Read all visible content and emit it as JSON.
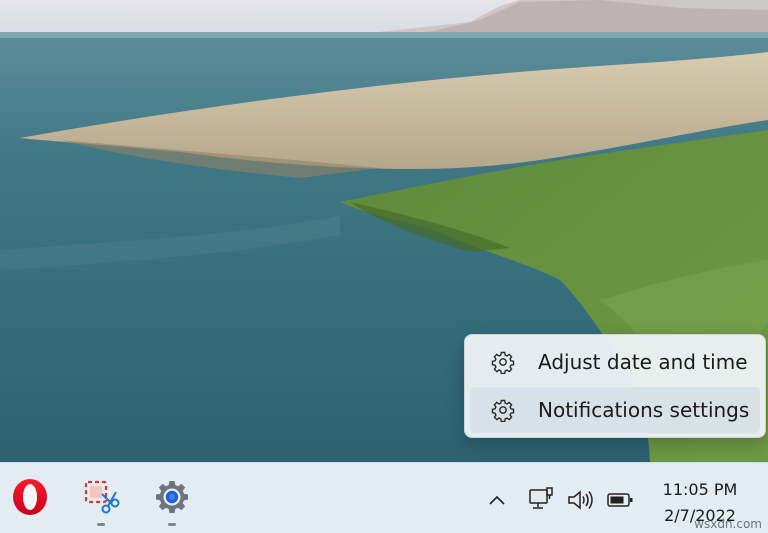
{
  "context_menu": {
    "items": [
      {
        "label": "Adjust date and time",
        "icon": "gear-icon"
      },
      {
        "label": "Notifications settings",
        "icon": "gear-icon"
      }
    ]
  },
  "taskbar": {
    "apps": [
      {
        "name": "Opera",
        "icon": "opera-icon",
        "running": false
      },
      {
        "name": "Snipping Tool",
        "icon": "snipping-tool-icon",
        "running": true
      },
      {
        "name": "Settings",
        "icon": "settings-icon",
        "running": true
      }
    ],
    "tray": {
      "overflow_icon": "chevron-up-icon",
      "network_icon": "ethernet-icon",
      "volume_icon": "speaker-icon",
      "battery_icon": "battery-icon"
    },
    "clock": {
      "time": "11:05 PM",
      "date": "2/7/2022"
    }
  },
  "watermark": "wsxdn.com",
  "colors": {
    "taskbar_bg": "#e2ecf2",
    "menu_bg": "#ecf1f4",
    "opera_red": "#e0001c",
    "settings_blue": "#1d5fd6"
  }
}
